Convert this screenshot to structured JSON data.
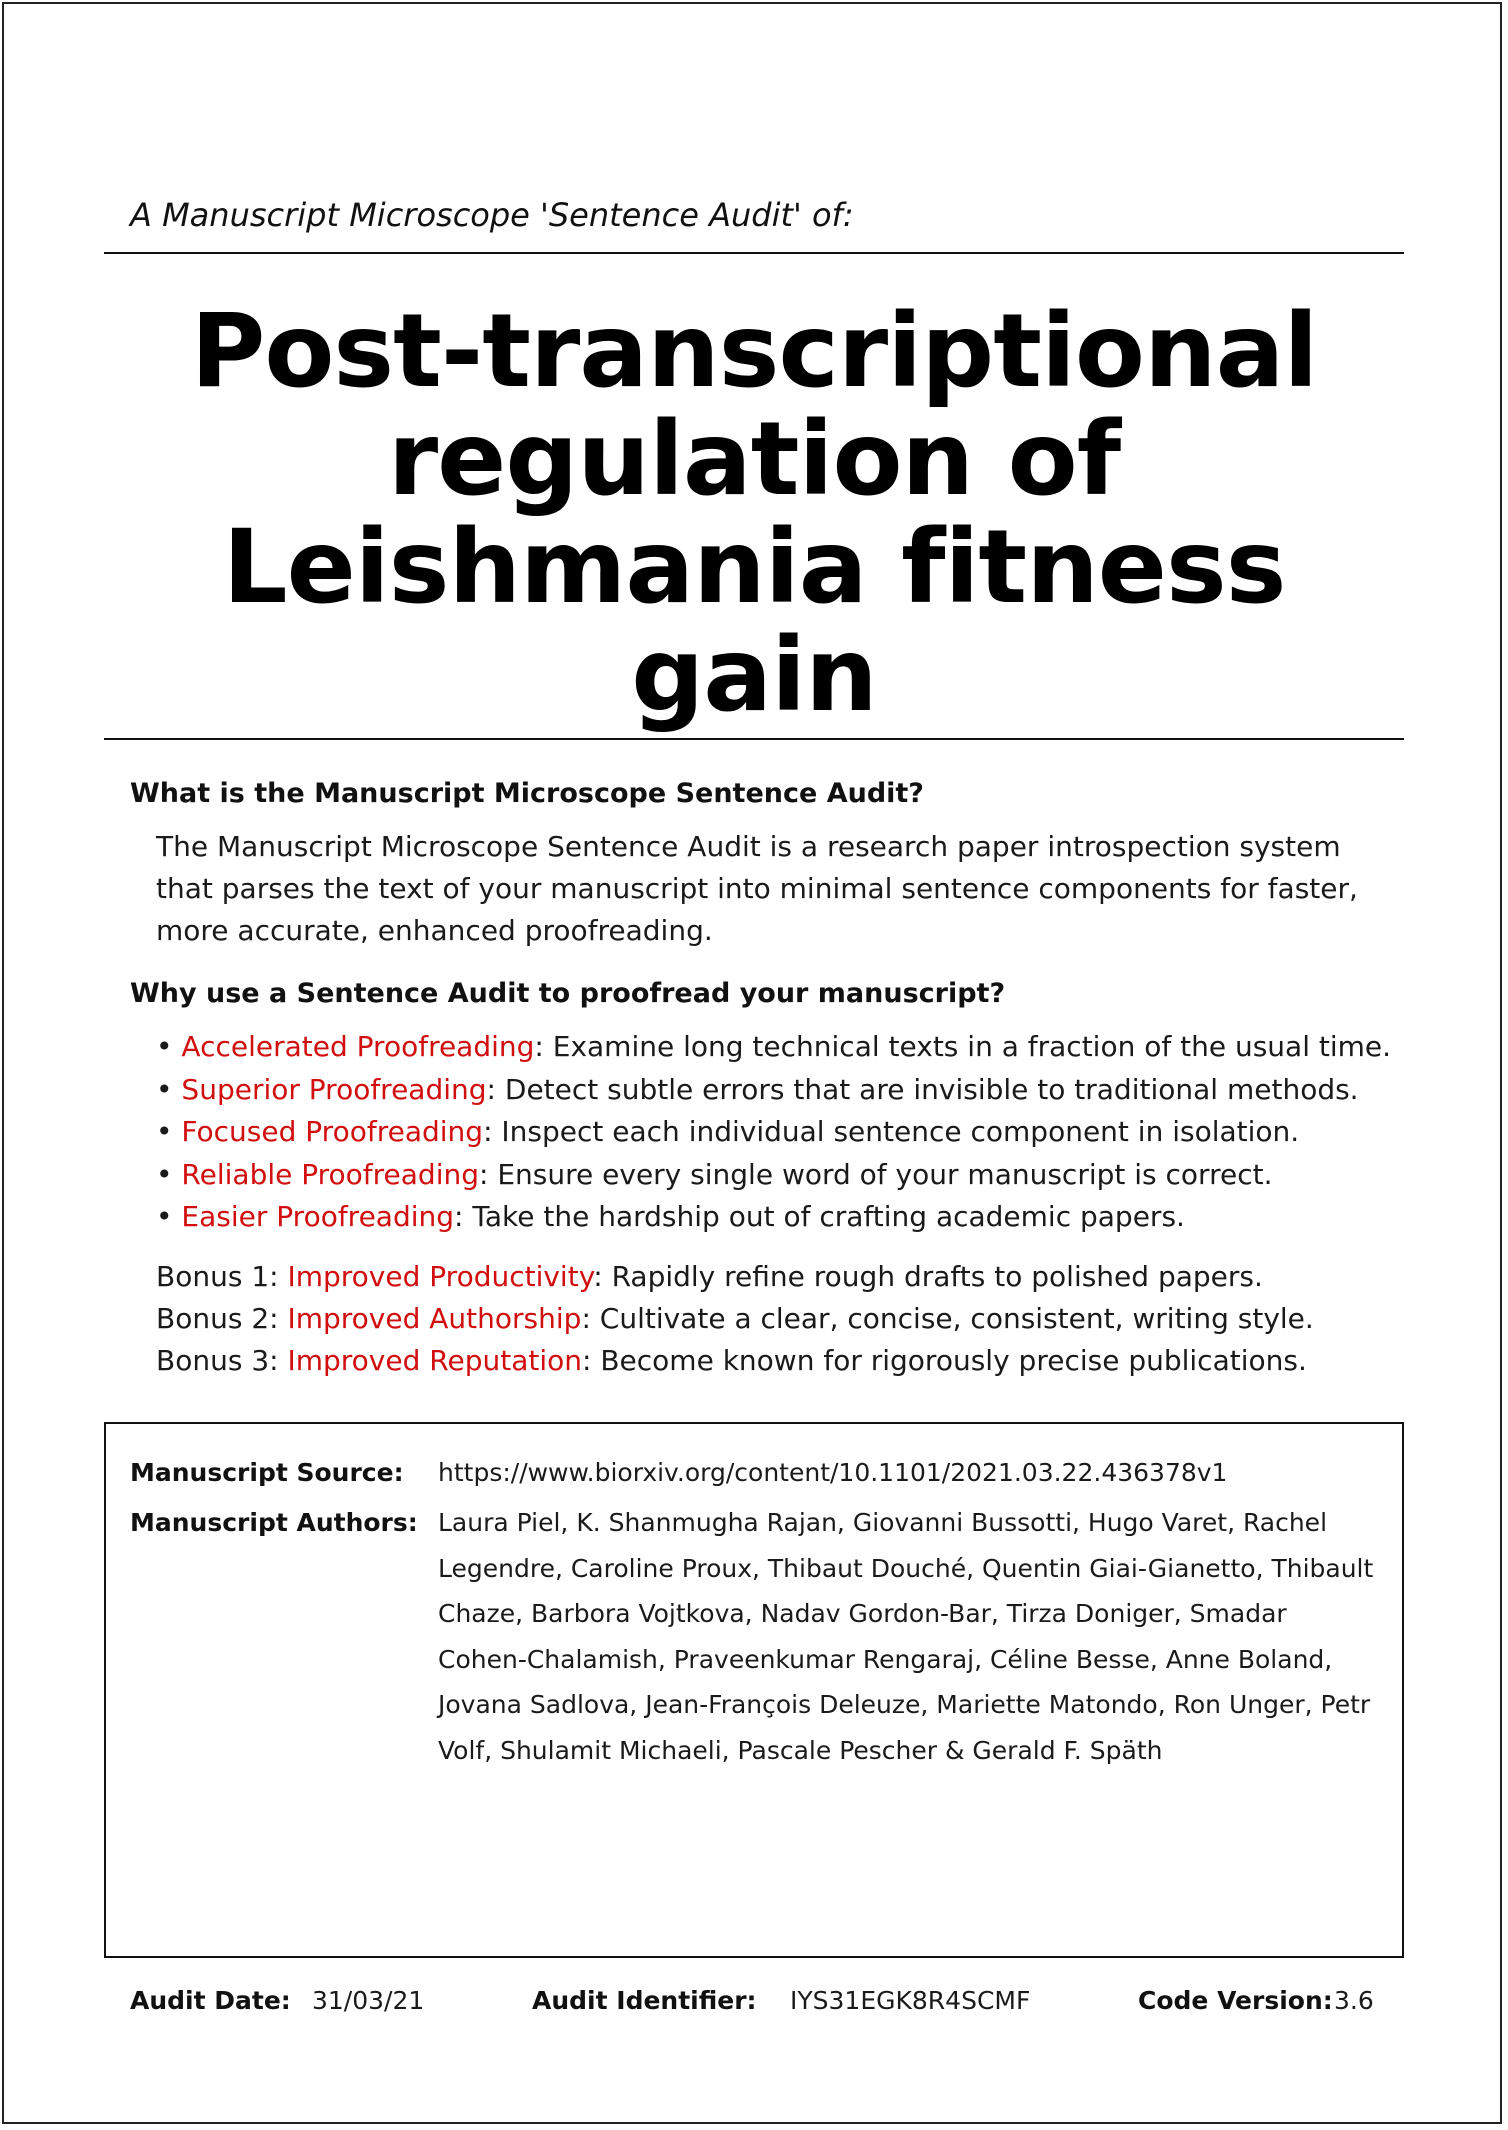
{
  "header": {
    "subtitle": "A Manuscript Microscope 'Sentence Audit' of:",
    "title_lines": [
      "Post-transcriptional",
      "regulation of",
      "Leishmania fitness",
      "gain"
    ]
  },
  "section1": {
    "heading": "What is the Manuscript Microscope Sentence Audit?",
    "paragraph": "The Manuscript Microscope Sentence Audit is a research paper introspection system that parses the text of your manuscript into minimal sentence components for faster, more accurate, enhanced proofreading."
  },
  "section2": {
    "heading": "Why use a Sentence Audit to proofread your manuscript?",
    "bullets": [
      {
        "marker": "• ",
        "term": "Accelerated Proofreading",
        "text": ": Examine long technical texts in a fraction of the usual time."
      },
      {
        "marker": "• ",
        "term": "Superior Proofreading",
        "text": ": Detect subtle errors that are invisible to traditional methods."
      },
      {
        "marker": "• ",
        "term": "Focused Proofreading",
        "text": ": Inspect each individual sentence component in isolation."
      },
      {
        "marker": "• ",
        "term": "Reliable Proofreading",
        "text": ": Ensure every single word of your manuscript is correct."
      },
      {
        "marker": "• ",
        "term": "Easier Proofreading",
        "text": ": Take the hardship out of crafting academic papers."
      }
    ],
    "bonuses": [
      {
        "prefix": "Bonus 1: ",
        "term": "Improved Productivity",
        "text": ": Rapidly refine rough drafts to polished papers."
      },
      {
        "prefix": "Bonus 2: ",
        "term": "Improved Authorship",
        "text": ": Cultivate a clear, concise, consistent, writing style."
      },
      {
        "prefix": "Bonus 3: ",
        "term": "Improved Reputation",
        "text": ": Become known for rigorously precise publications."
      }
    ]
  },
  "info": {
    "source_label": "Manuscript Source:",
    "source_value": "https://www.biorxiv.org/content/10.1101/2021.03.22.436378v1",
    "authors_label": "Manuscript Authors:",
    "authors_value": "Laura Piel, K. Shanmugha Rajan, Giovanni Bussotti, Hugo Varet, Rachel Legendre, Caroline Proux, Thibaut Douché, Quentin Giai-Gianetto, Thibault Chaze, Barbora Vojtkova, Nadav Gordon-Bar, Tirza Doniger, Smadar Cohen-Chalamish, Praveenkumar Rengaraj, Céline Besse, Anne Boland, Jovana Sadlova, Jean-François Deleuze, Mariette Matondo, Ron Unger, Petr Volf, Shulamit Michaeli, Pascale Pescher & Gerald F. Späth"
  },
  "footer": {
    "date_label": "Audit Date:",
    "date_value": "31/03/21",
    "id_label": "Audit Identifier:",
    "id_value": "IYS31EGK8R4SCMF",
    "version_label": "Code Version:",
    "version_value": "3.6"
  },
  "colors": {
    "accent_red": "#d10f0f"
  }
}
